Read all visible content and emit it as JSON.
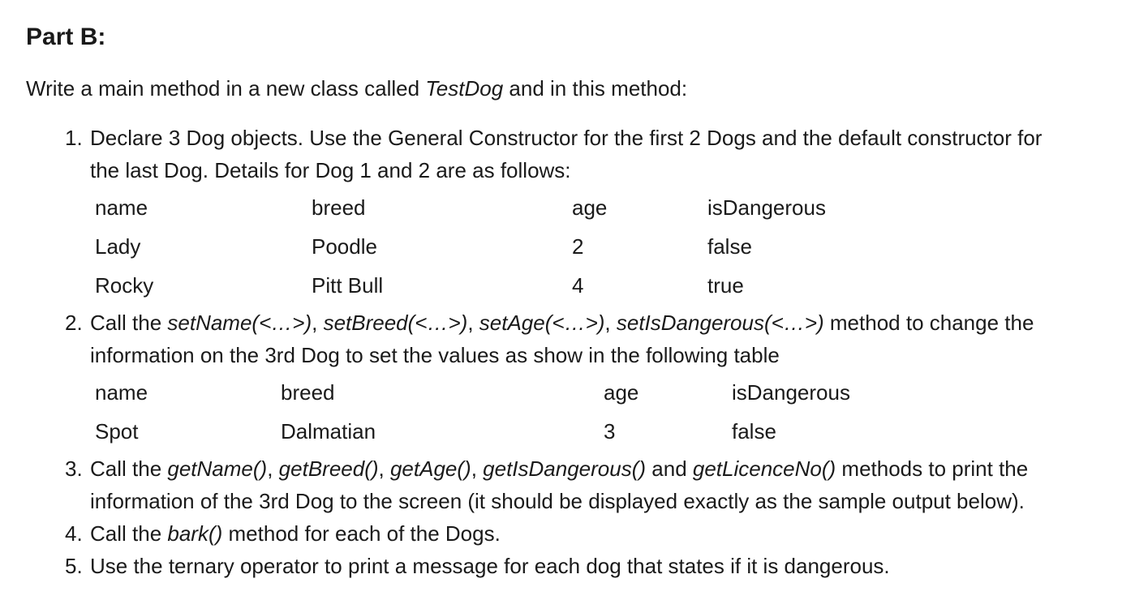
{
  "heading": "Part B:",
  "intro": {
    "before": "Write a main method in a new class called ",
    "class_name": "TestDog",
    "after": " and in this method:"
  },
  "steps": [
    {
      "number": "1.",
      "line1": "Declare 3 Dog objects. Use the General Constructor for the first 2 Dogs and the default constructor for",
      "line2": "the last Dog. Details for Dog 1 and 2 are as follows:"
    },
    {
      "number": "2.",
      "prefix": "Call the ",
      "m1": "setName(<…>)",
      "sep1": ", ",
      "m2": "setBreed(<…>)",
      "sep2": ", ",
      "m3": "setAge(<…>)",
      "sep3": ", ",
      "m4": "setIsDangerous(<…>)",
      "suffix": " method to change the",
      "line2": "information on the 3rd Dog to set the values as show in the following table"
    },
    {
      "number": "3.",
      "prefix": "Call the ",
      "m1": "getName()",
      "sep1": ", ",
      "m2": "getBreed()",
      "sep2": ", ",
      "m3": "getAge()",
      "sep3": ", ",
      "m4": "getIsDangerous()",
      "sep4": " and ",
      "m5": "getLicenceNo()",
      "suffix": " methods to print the",
      "line2": "information of the 3rd Dog to the screen (it should be displayed exactly as the sample output below)."
    },
    {
      "number": "4.",
      "prefix": "Call the ",
      "m1": "bark()",
      "suffix": " method for each of the Dogs."
    },
    {
      "number": "5.",
      "text": "Use the ternary operator to print a message for each dog that states if it is dangerous."
    }
  ],
  "table1": {
    "headers": [
      "name",
      "breed",
      "age",
      "isDangerous"
    ],
    "rows": [
      [
        "Lady",
        "Poodle",
        "2",
        "false"
      ],
      [
        "Rocky",
        "Pitt Bull",
        "4",
        "true"
      ]
    ]
  },
  "table2": {
    "headers": [
      "name",
      "breed",
      "age",
      "isDangerous"
    ],
    "rows": [
      [
        "Spot",
        "Dalmatian",
        "3",
        "false"
      ]
    ]
  }
}
